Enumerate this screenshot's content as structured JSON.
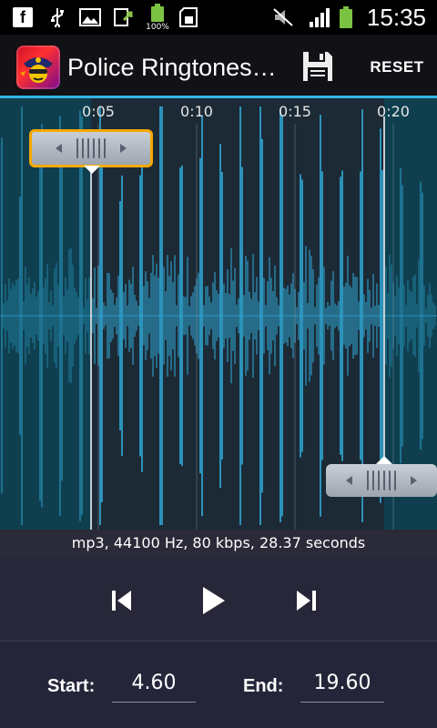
{
  "status_bar": {
    "time": "15:35",
    "battery_badge": "100%",
    "icons": [
      "facebook-icon",
      "usb-icon",
      "picture-icon",
      "download-icon",
      "battery-full-icon",
      "sd-card-icon",
      "mute-icon",
      "signal-icon",
      "battery-icon"
    ]
  },
  "action_bar": {
    "title": "Police Ringtones…",
    "reset_label": "RESET",
    "icons": [
      "app-logo-icon",
      "save-icon"
    ],
    "accent_color": "#33b5e5"
  },
  "waveform": {
    "time_labels": [
      "0:05",
      "0:10",
      "0:15",
      "0:20"
    ],
    "wave_color": "#33b5e5",
    "background_color": "#0f3f4f"
  },
  "file_info": "mp3, 44100 Hz, 80 kbps, 28.37 seconds",
  "transport": {
    "icons": [
      "skip-back-icon",
      "play-icon",
      "skip-forward-icon"
    ]
  },
  "selection": {
    "start_label": "Start:",
    "start_value": "4.60",
    "end_label": "End:",
    "end_value": "19.60"
  }
}
